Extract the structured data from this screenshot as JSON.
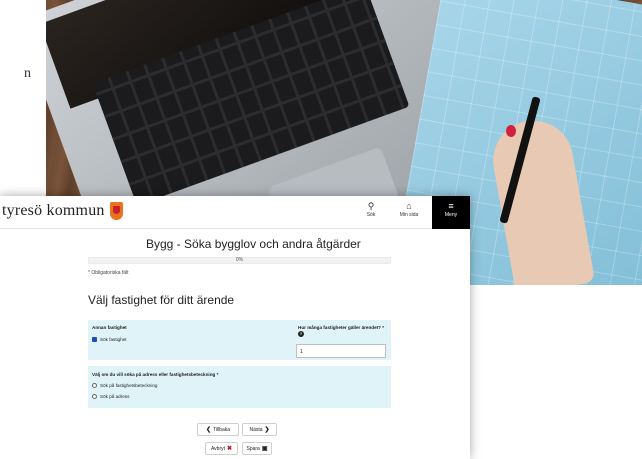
{
  "background_text": {
    "side_letter": "n"
  },
  "header": {
    "logo_text": "tyresö kommun",
    "search": {
      "icon": "search-icon",
      "label": "Sök"
    },
    "my_page": {
      "icon": "home-icon",
      "label": "Min sida"
    },
    "menu": {
      "icon": "hamburger-icon",
      "label": "Meny"
    }
  },
  "form": {
    "title": "Bygg - Söka bygglov och andra åtgärder",
    "progress": {
      "percent": 0,
      "label": "0%"
    },
    "required_note": "* Obligatoriska fält",
    "section_heading": "Välj fastighet för ditt ärende",
    "panel1": {
      "other_property_label": "Annan fastighet",
      "search_property_checkbox": "Sök fastighet",
      "count_label": "Hur många fastigheter gäller ärendet? *",
      "count_value": "1"
    },
    "panel2": {
      "question": "Välj om du vill söka på adress eller fastighetsbeteckning *",
      "option1": "Sök på fastighetsbeteckning",
      "option2": "Sök på adress"
    },
    "buttons": {
      "back": "Tillbaka",
      "next": "Nästa",
      "cancel": "Avbryt",
      "save": "Spara"
    }
  },
  "colors": {
    "panel_bg": "#dff3f8",
    "checkbox": "#1f4fb5",
    "menu_bg": "#000000",
    "logo_orange": "#e8731c",
    "logo_red": "#c71f2d"
  }
}
